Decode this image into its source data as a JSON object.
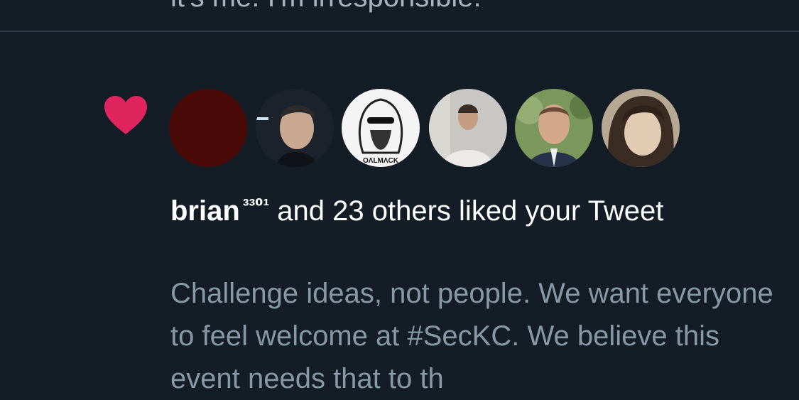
{
  "previous_tweet": {
    "text": "it's me. I'm irresponsible."
  },
  "notification": {
    "icon": "heart-icon",
    "icon_color": "#e0245e",
    "avatars": [
      {
        "name": "avatar-1",
        "color": "#4a0a07"
      },
      {
        "name": "avatar-2",
        "color": "#2a2e35"
      },
      {
        "name": "avatar-3",
        "color": "#f2f2f2"
      },
      {
        "name": "avatar-4",
        "color": "#b9b7b3"
      },
      {
        "name": "avatar-5",
        "color": "#6f8a56"
      },
      {
        "name": "avatar-6",
        "color": "#a89a86"
      }
    ],
    "user_name": "brian",
    "user_name_suffix": "³³⁰¹",
    "action_text": "and 23 others liked your Tweet",
    "tweet_preview": "Challenge ideas, not people. We want everyone to feel welcome at #SecKC. We believe this event needs that to th"
  }
}
